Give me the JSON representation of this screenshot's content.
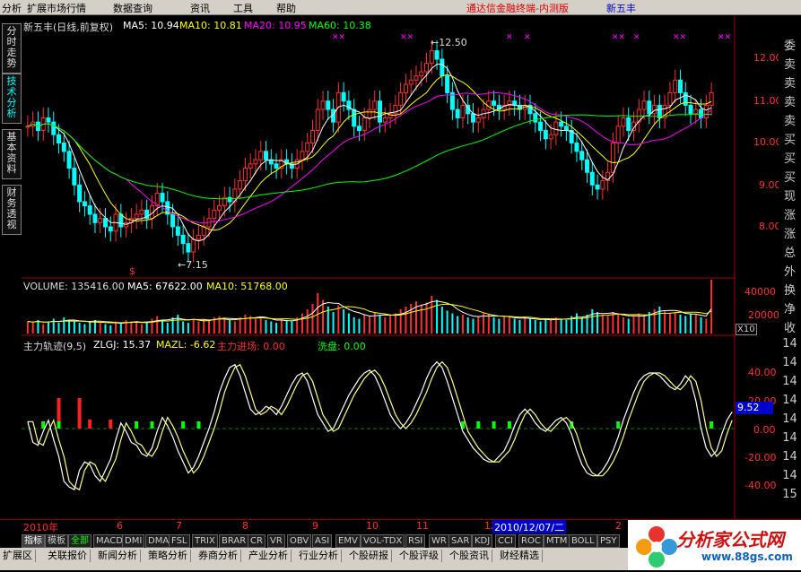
{
  "menu": {
    "items": [
      "分析",
      "扩展市场行情",
      "数据查询",
      "资讯",
      "工具",
      "帮助"
    ],
    "app_title": "通达信金融终端-内测版",
    "stock_title": "新五丰"
  },
  "left_tabs": [
    "分时走势",
    "技术分析",
    "基本资料",
    "财务透视"
  ],
  "main_chart": {
    "header": "新五丰(日线,前复权)",
    "ma5_label": "MA5: 10.94",
    "ma10_label": "MA10: 10.81",
    "ma20_label": "MA20: 10.95",
    "ma60_label": "MA60: 10.38",
    "high_note": "12.50",
    "low_note": "7.15",
    "y_ticks": [
      "12.00",
      "11.00",
      "10.00",
      "9.00",
      "8.00"
    ],
    "colors": {
      "ma5": "#ffffff",
      "ma10": "#ffff00",
      "ma20": "#ff00ff",
      "ma60": "#00ff00",
      "up": "#ff3030",
      "down": "#00ffff"
    }
  },
  "volume_panel": {
    "header": "VOLUME: 135416.00",
    "ma5_label": "MA5: 67622.00",
    "ma10_label": "MA10: 51768.00",
    "y_ticks": [
      "40000",
      "20000"
    ],
    "unit": "X10"
  },
  "indicator_panel": {
    "name": "主力轨迹(9,5)",
    "zlgj_label": "ZLGJ: 15.37",
    "mazl_label": "MAZL: -6.62",
    "entry_label": "主力进场: 0.00",
    "wash_label": "洗盘: 0.00",
    "y_ticks": [
      "40.00",
      "20.00",
      "0.00",
      "-20.00",
      "-40.00"
    ],
    "current_value": "9.52"
  },
  "time_axis": {
    "year_label": "2010年",
    "months": [
      "6",
      "7",
      "8",
      "9",
      "10",
      "11",
      "12"
    ],
    "cursor_date": "2010/12/07/二",
    "tail_month": "2"
  },
  "indicator_tabs": [
    "指标",
    "模板",
    "全部",
    "MACD",
    "DMI",
    "DMA",
    "FSL",
    "TRIX",
    "BRAR",
    "CR",
    "VR",
    "OBV",
    "ASI",
    "EMV",
    "VOL-TDX",
    "RSI",
    "WR",
    "SAR",
    "KDJ",
    "CCI",
    "ROC",
    "MTM",
    "BOLL",
    "PSY"
  ],
  "bottom_tabs": [
    "扩展区",
    "关联报价",
    "新闻分析",
    "策略分析",
    "券商分析",
    "产业分析",
    "行业分析",
    "个股研报",
    "个股评级",
    "个股资讯",
    "财经精选"
  ],
  "right_strip": [
    "委",
    "卖",
    "卖",
    "卖",
    "卖",
    "买",
    "买",
    "买",
    "现",
    "涨",
    "涨",
    "总",
    "外",
    "换",
    "净",
    "收",
    "14",
    "14",
    "14",
    "14",
    "14",
    "14",
    "14",
    "14",
    "15"
  ],
  "logo": {
    "text": "分析家公式网",
    "url": "www.88gs.com"
  },
  "series": {
    "close": [
      10.4,
      10.5,
      10.3,
      10.6,
      10.5,
      10.2,
      10.0,
      9.8,
      9.4,
      9.0,
      8.6,
      8.5,
      8.3,
      8.1,
      8.2,
      8.0,
      7.9,
      8.3,
      8.0,
      8.1,
      8.2,
      8.3,
      8.4,
      8.2,
      8.5,
      8.8,
      8.6,
      8.3,
      8.0,
      7.8,
      7.6,
      7.4,
      7.7,
      7.8,
      8.0,
      8.2,
      8.4,
      8.5,
      8.7,
      8.6,
      8.9,
      9.1,
      9.4,
      9.5,
      9.6,
      9.8,
      9.6,
      9.5,
      9.4,
      9.6,
      9.5,
      9.4,
      9.6,
      9.8,
      10.0,
      10.3,
      10.8,
      11.0,
      10.8,
      10.5,
      11.2,
      11.0,
      10.8,
      10.4,
      10.3,
      10.6,
      10.8,
      11.0,
      10.5,
      10.6,
      10.7,
      10.9,
      11.2,
      11.4,
      11.5,
      11.6,
      11.7,
      11.9,
      12.2,
      12.0,
      11.6,
      11.2,
      10.8,
      10.6,
      10.9,
      10.7,
      10.5,
      10.6,
      10.8,
      11.0,
      10.9,
      10.8,
      10.9,
      11.0,
      10.9,
      10.8,
      10.9,
      10.7,
      10.5,
      10.3,
      10.1,
      10.2,
      10.5,
      10.4,
      10.3,
      10.0,
      9.8,
      9.6,
      9.3,
      9.0,
      8.9,
      9.1,
      9.3,
      10.0,
      10.4,
      10.6,
      10.3,
      10.5,
      10.8,
      11.0,
      10.7,
      10.9,
      10.6,
      10.9,
      11.2,
      11.5,
      11.2,
      10.9,
      10.7,
      10.8,
      10.6,
      10.9,
      11.2
    ],
    "volume": [
      9,
      8,
      10,
      7,
      9,
      11,
      8,
      12,
      10,
      9,
      8,
      7,
      9,
      10,
      8,
      7,
      6,
      9,
      8,
      10,
      9,
      8,
      7,
      9,
      11,
      13,
      10,
      8,
      12,
      14,
      9,
      8,
      10,
      9,
      11,
      10,
      12,
      13,
      11,
      10,
      9,
      12,
      14,
      13,
      11,
      12,
      10,
      9,
      8,
      11,
      10,
      9,
      12,
      15,
      18,
      22,
      30,
      25,
      20,
      16,
      21,
      18,
      15,
      12,
      11,
      14,
      13,
      16,
      14,
      12,
      13,
      15,
      18,
      20,
      22,
      24,
      21,
      23,
      28,
      25,
      20,
      17,
      15,
      13,
      14,
      12,
      11,
      13,
      15,
      14,
      12,
      11,
      13,
      12,
      11,
      10,
      12,
      11,
      10,
      9,
      11,
      10,
      12,
      11,
      10,
      13,
      15,
      12,
      14,
      18,
      16,
      14,
      13,
      16,
      14,
      12,
      11,
      13,
      15,
      14,
      16,
      18,
      20,
      17,
      15,
      16,
      14,
      13,
      15,
      14,
      12,
      11,
      40
    ],
    "zlgj": [
      5,
      -10,
      -12,
      -2,
      6,
      -8,
      -20,
      -38,
      -42,
      -44,
      -30,
      -24,
      -26,
      -34,
      -38,
      -30,
      -22,
      -8,
      4,
      -2,
      -10,
      -12,
      -18,
      -20,
      -14,
      -2,
      8,
      2,
      -6,
      -16,
      -24,
      -32,
      -28,
      -20,
      -10,
      0,
      12,
      26,
      36,
      44,
      46,
      38,
      26,
      14,
      10,
      12,
      16,
      14,
      10,
      16,
      24,
      32,
      38,
      40,
      34,
      22,
      10,
      4,
      -2,
      0,
      8,
      16,
      24,
      30,
      36,
      40,
      42,
      38,
      30,
      20,
      10,
      4,
      0,
      4,
      10,
      18,
      26,
      36,
      44,
      48,
      44,
      34,
      22,
      10,
      -2,
      -8,
      -14,
      -18,
      -22,
      -24,
      -24,
      -20,
      -16,
      -8,
      2,
      10,
      14,
      10,
      4,
      0,
      -2,
      2,
      6,
      8,
      4,
      -4,
      -16,
      -26,
      -32,
      -34,
      -34,
      -30,
      -24,
      -16,
      -6,
      6,
      16,
      26,
      34,
      38,
      40,
      40,
      38,
      34,
      30,
      28,
      32,
      38,
      34,
      20,
      0,
      -14,
      -20,
      -16,
      -4,
      6,
      12
    ]
  }
}
